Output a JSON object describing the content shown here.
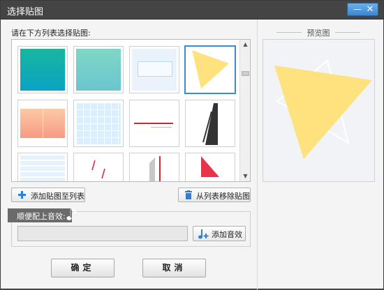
{
  "window": {
    "title": "选择贴图",
    "minimize_glyph": "—",
    "close_glyph": "✕"
  },
  "list": {
    "label": "请在下方列表选择贴图:"
  },
  "thumbnails": [
    {
      "id": "teal-gradient"
    },
    {
      "id": "mint-gradient"
    },
    {
      "id": "light-frame"
    },
    {
      "id": "yellow-triangle",
      "selected": true
    },
    {
      "id": "peach-panels"
    },
    {
      "id": "blue-grid"
    },
    {
      "id": "red-line"
    },
    {
      "id": "black-slashes"
    },
    {
      "id": "blue-stripes"
    },
    {
      "id": "red-dashes"
    },
    {
      "id": "gray-bar"
    },
    {
      "id": "red-shape"
    }
  ],
  "buttons": {
    "add_to_list": "添加贴图至列表",
    "remove_from_list": "从列表移除贴图",
    "add_sound": "添加音效",
    "ok": "确定",
    "cancel": "取消"
  },
  "sound": {
    "section_label": "顺便配上音效:",
    "value": ""
  },
  "preview": {
    "label": "预览图"
  },
  "colors": {
    "titlebar": "#444444",
    "accent": "#3b8ad9",
    "triangle": "#fde27e"
  },
  "icons": [
    "plus-icon",
    "trash-icon",
    "music-note-icon",
    "add-music-icon",
    "minimize-icon",
    "close-icon",
    "scroll-up-icon",
    "scroll-down-icon"
  ]
}
